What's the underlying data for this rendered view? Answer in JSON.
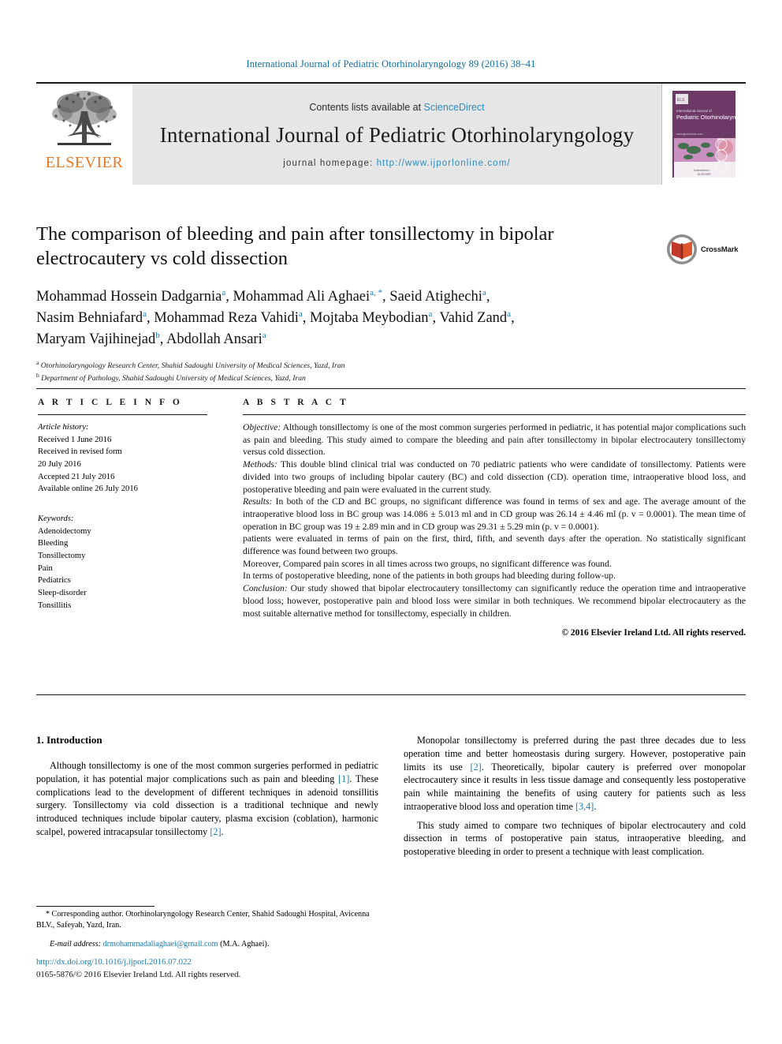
{
  "running_head": "International Journal of Pediatric Otorhinolaryngology 89 (2016) 38–41",
  "masthead": {
    "publisher": "ELSEVIER",
    "contents_prefix": "Contents lists available at ",
    "contents_link": "ScienceDirect",
    "journal_name": "International Journal of Pediatric Otorhinolaryngology",
    "homepage_label": "journal homepage: ",
    "homepage_url": "http://www.ijporlonline.com/",
    "cover_title_small": "International Journal of",
    "cover_title_main": "Pediatric Otorhinolaryngology"
  },
  "crossmark": {
    "label": "CrossMark"
  },
  "article": {
    "title": "The comparison of bleeding and pain after tonsillectomy in bipolar electrocautery vs cold dissection",
    "authors_line_1": "Mohammad Hossein Dadgarnia",
    "authors_line_2": "Mohammad Ali Aghaei",
    "authors_line_3": "Saeid Atighechi",
    "authors_line_4": "Nasim Behniafard",
    "authors_line_5": "Mohammad Reza Vahidi",
    "authors_line_6": "Mojtaba Meybodian",
    "authors_line_7": "Vahid Zand",
    "authors_line_8": "Maryam Vajihinejad",
    "authors_line_9": "Abdollah Ansari",
    "affiliation_a": "Otorhinolaryngology Research Center, Shahid Sadoughi University of Medical Sciences, Yazd, Iran",
    "affiliation_b": "Department of Pathology, Shahid Sadoughi University of Medical Sciences, Yazd, Iran"
  },
  "article_info": {
    "heading": "A R T I C L E    I N F O",
    "history_label": "Article history:",
    "received": "Received 1 June 2016",
    "revised_label": "Received in revised form",
    "revised_date": "20 July 2016",
    "accepted": "Accepted 21 July 2016",
    "available": "Available online 26 July 2016",
    "keywords_label": "Keywords:",
    "keywords": [
      "Adenoidectomy",
      "Bleeding",
      "Tonsillectomy",
      "Pain",
      "Pediatrics",
      "Sleep-disorder",
      "Tonsillitis"
    ]
  },
  "abstract": {
    "heading": "A B S T R A C T",
    "objective_label": "Objective:",
    "objective_text": " Although tonsillectomy is one of the most common surgeries performed in pediatric, it has potential major complications such as pain and bleeding. This study aimed to compare the bleeding and pain after tonsillectomy in bipolar electrocautery tonsillectomy versus cold dissection.",
    "methods_label": "Methods:",
    "methods_text": " This double blind clinical trial was conducted on 70 pediatric patients who were candidate of tonsillectomy. Patients were divided into two groups of including bipolar cautery (BC) and cold dissection (CD). operation time, intraoperative blood loss, and postoperative bleeding and pain were evaluated in the current study.",
    "results_label": "Results:",
    "results_text": "  In both of the CD and BC groups, no significant difference was found in terms of sex and age. The average amount of the intraoperative blood loss in BC group was 14.086 ± 5.013 ml and in CD group was 26.14 ± 4.46 ml (p. v = 0.0001). The mean time of operation in BC group was 19 ± 2.89 min and in CD group was 29.31 ± 5.29 min (p. v = 0.0001).",
    "results_extra_1": "patients were evaluated in terms of pain on the first, third, fifth, and seventh days after the operation. No statistically significant difference was found between two groups.",
    "results_extra_2": "Moreover, Compared pain scores in all times across two groups, no significant difference was found.",
    "results_extra_3": "In terms of postoperative bleeding, none of the patients in both groups had bleeding during follow-up.",
    "conclusion_label": "Conclusion:",
    "conclusion_text": " Our study showed that bipolar electrocautery tonsillectomy can significantly reduce the operation time and intraoperative blood loss; however, postoperative pain and blood loss were similar in both techniques. We recommend bipolar electrocautery as the most suitable alternative method for tonsillectomy, especially in children.",
    "copyright": "© 2016 Elsevier Ireland Ltd. All rights reserved."
  },
  "introduction": {
    "heading": "1. Introduction",
    "para_1_a": "Although tonsillectomy is one of the most common surgeries performed in pediatric population, it has potential major complications such as pain and bleeding ",
    "para_1_cite_1": "[1]",
    "para_1_b": ". These complications lead to the development of different techniques in adenoid tonsillitis surgery. Tonsillectomy via cold dissection is a traditional technique and newly introduced techniques include bipolar cautery, plasma excision (coblation), harmonic scalpel, powered intracapsular tonsillectomy ",
    "para_1_cite_2": "[2]",
    "para_1_c": ".",
    "para_2_a": "Monopolar tonsillectomy is preferred during the past three decades due to less operation time and better homeostasis during surgery. However, postoperative pain limits its use ",
    "para_2_cite_1": "[2]",
    "para_2_b": ". Theoretically, bipolar cautery is preferred over monopolar electrocautery since it results in less tissue damage and consequently less postoperative pain while maintaining the benefits of using cautery for patients such as less intraoperative blood loss and operation time ",
    "para_2_cite_2": "[3,4]",
    "para_2_c": ".",
    "para_3": "This study aimed to compare two techniques of bipolar electrocautery and cold dissection in terms of postoperative pain status, intraoperative bleeding, and postoperative bleeding in order to present a technique with least complication."
  },
  "footnotes": {
    "corresponding_star": "*",
    "corresponding_text": " Corresponding author. Otorhinolaryngology Research Center, Shahid Sadoughi Hospital, Avicenna BLV., Safeyah, Yazd, Iran.",
    "email_label": "E-mail address:",
    "email_address": "drmohammadaliaghaei@gmail.com",
    "email_suffix": " (M.A. Aghaei).",
    "doi_url": "http://dx.doi.org/10.1016/j.ijporl.2016.07.022",
    "issn_line": "0165-5876/© 2016 Elsevier Ireland Ltd. All rights reserved."
  }
}
